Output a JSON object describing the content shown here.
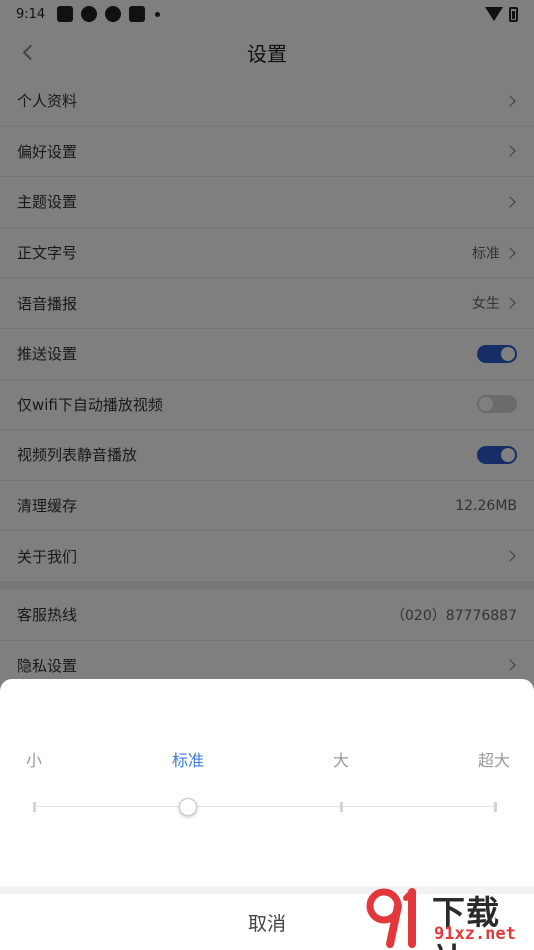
{
  "status_bar": {
    "time": "9:14"
  },
  "header": {
    "title": "设置"
  },
  "settings": [
    {
      "label": "个人资料",
      "value": "",
      "control": "chevron"
    },
    {
      "label": "偏好设置",
      "value": "",
      "control": "chevron"
    },
    {
      "label": "主题设置",
      "value": "",
      "control": "chevron"
    },
    {
      "label": "正文字号",
      "value": "标准",
      "control": "chevron"
    },
    {
      "label": "语音播报",
      "value": "女生",
      "control": "chevron"
    },
    {
      "label": "推送设置",
      "value": "",
      "control": "toggle",
      "on": true
    },
    {
      "label": "仅wifi下自动播放视频",
      "value": "",
      "control": "toggle",
      "on": false
    },
    {
      "label": "视频列表静音播放",
      "value": "",
      "control": "toggle",
      "on": true
    },
    {
      "label": "清理缓存",
      "value": "12.26MB",
      "control": "text"
    },
    {
      "label": "关于我们",
      "value": "",
      "control": "chevron"
    }
  ],
  "support": [
    {
      "label": "客服热线",
      "value": "（020）87776887",
      "control": "text"
    },
    {
      "label": "隐私设置",
      "value": "",
      "control": "chevron"
    }
  ],
  "font_size_picker": {
    "options": [
      "小",
      "标准",
      "大",
      "超大"
    ],
    "selected_index": 1,
    "cancel_label": "取消"
  },
  "watermark": {
    "brand": "下载站",
    "domain": "91xz.net"
  },
  "colors": {
    "accent": "#2b5dcc",
    "selected_text": "#3d7be0",
    "watermark_red": "#e3383b"
  }
}
